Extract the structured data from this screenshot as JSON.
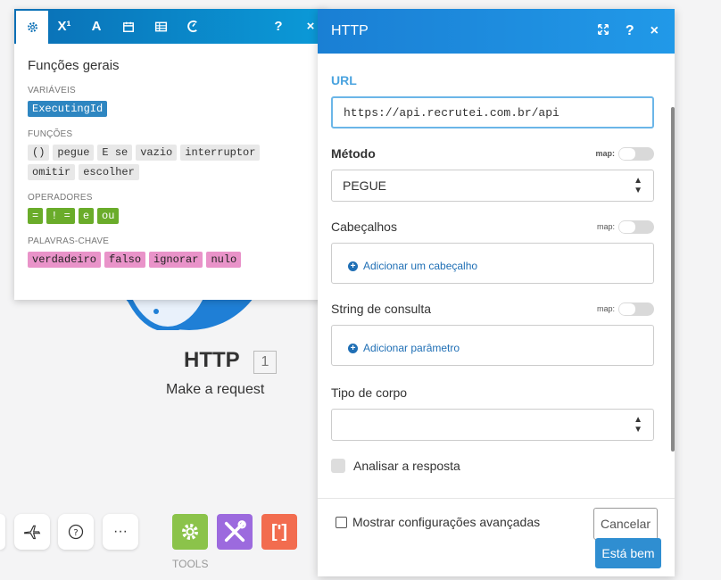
{
  "module": {
    "title": "HTTP",
    "badge": "1",
    "subtitle": "Make a request"
  },
  "toolbar": {
    "tools_label": "TOOLS"
  },
  "popup": {
    "title": "Funções gerais",
    "sections": {
      "variables": {
        "label": "VARIÁVEIS",
        "items": [
          "ExecutingId"
        ]
      },
      "functions": {
        "label": "FUNÇÕES",
        "items": [
          "()",
          "pegue",
          "E se",
          "vazio",
          "interruptor",
          "omitir",
          "escolher"
        ]
      },
      "operators": {
        "label": "OPERADORES",
        "items": [
          "=",
          "! =",
          "e",
          "ou"
        ]
      },
      "keywords": {
        "label": "PALAVRAS-CHAVE",
        "items": [
          "verdadeiro",
          "falso",
          "ignorar",
          "nulo"
        ]
      }
    },
    "tabs": [
      "gear-icon",
      "superscript-icon",
      "text-icon",
      "calendar-icon",
      "table-icon",
      "gauge-icon"
    ],
    "help": "?",
    "close": "×"
  },
  "panel": {
    "title": "HTTP",
    "help": "?",
    "close": "×",
    "url_label": "URL",
    "url_value": "https://api.recrutei.com.br/api",
    "method_label": "Método",
    "method_value": "PEGUE",
    "map_label": "map:",
    "headers_label": "Cabeçalhos",
    "headers_add": "Adicionar um cabeçalho",
    "query_label": "String de consulta",
    "query_add": "Adicionar parâmetro",
    "body_label": "Tipo de corpo",
    "body_value": "",
    "parse_label": "Analisar a resposta",
    "advanced_label": "Mostrar configurações avançadas",
    "cancel": "Cancelar",
    "ok": "Está bem"
  },
  "colors": {
    "header_blue": "#1a7fd4",
    "variable": "#2e86c1",
    "operator": "#6aac2a",
    "keyword": "#e993c9",
    "tools_green": "#8bc34a",
    "tools_purple": "#9c6ade",
    "tools_red": "#f26c4f"
  }
}
